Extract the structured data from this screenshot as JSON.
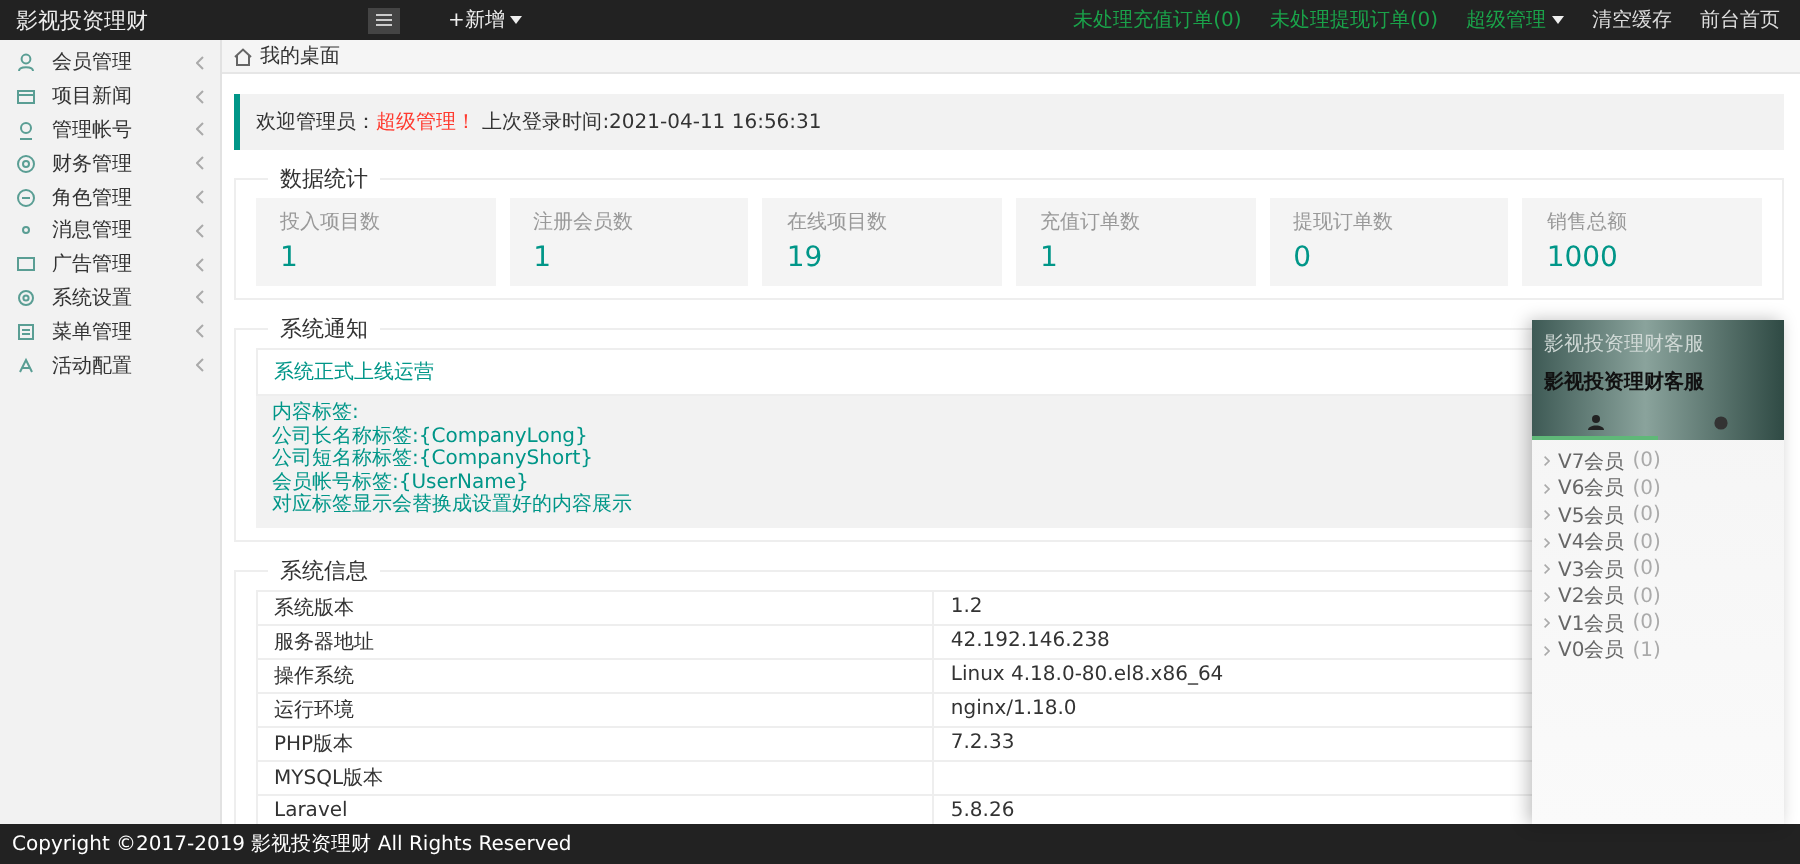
{
  "topbar": {
    "logo": "影视投资理财",
    "add_menu": "+新增",
    "links": [
      {
        "label": "未处理充值订单(0)",
        "kind": "alert"
      },
      {
        "label": "未处理提现订单(0)",
        "kind": "alert"
      },
      {
        "label": "超级管理",
        "kind": "dropdown"
      },
      {
        "label": "清空缓存",
        "kind": "plain"
      },
      {
        "label": "前台首页",
        "kind": "plain"
      }
    ]
  },
  "sidebar": {
    "items": [
      {
        "label": "会员管理"
      },
      {
        "label": "项目新闻"
      },
      {
        "label": "管理帐号"
      },
      {
        "label": "财务管理"
      },
      {
        "label": "角色管理"
      },
      {
        "label": "消息管理"
      },
      {
        "label": "广告管理"
      },
      {
        "label": "系统设置"
      },
      {
        "label": "菜单管理"
      },
      {
        "label": "活动配置"
      }
    ]
  },
  "breadcrumb": "我的桌面",
  "welcome": {
    "prefix": "欢迎管理员：",
    "role": "超级管理！",
    "last_login": "上次登录时间:2021-04-11 16:56:31"
  },
  "stats": {
    "title": "数据统计",
    "cards": [
      {
        "label": "投入项目数",
        "value": "1"
      },
      {
        "label": "注册会员数",
        "value": "1"
      },
      {
        "label": "在线项目数",
        "value": "19"
      },
      {
        "label": "充值订单数",
        "value": "1"
      },
      {
        "label": "提现订单数",
        "value": "0"
      },
      {
        "label": "销售总额",
        "value": "1000"
      }
    ]
  },
  "notice": {
    "title": "系统通知",
    "heading": "系统正式上线运营",
    "lines": [
      "内容标签:",
      "公司长名称标签:{CompanyLong}",
      "公司短名称标签:{CompanyShort}",
      "会员帐号标签:{UserName}",
      "对应标签显示会替换成设置好的内容展示"
    ]
  },
  "system_info": {
    "title": "系统信息",
    "rows": [
      {
        "name": "系统版本",
        "value": "1.2"
      },
      {
        "name": "服务器地址",
        "value": "42.192.146.238"
      },
      {
        "name": "操作系统",
        "value": "Linux 4.18.0-80.el8.x86_64"
      },
      {
        "name": "运行环境",
        "value": "nginx/1.18.0"
      },
      {
        "name": "PHP版本",
        "value": "7.2.33"
      },
      {
        "name": "MYSQL版本"
      },
      {
        "name": "Laravel",
        "value": "5.8.26"
      }
    ]
  },
  "chat_panel": {
    "title": "影视投资理财客服",
    "subtitle": "影视投资理财客服",
    "tabs": [
      {
        "kind": "person",
        "selected": true
      },
      {
        "kind": "chat",
        "selected": false
      }
    ],
    "groups": [
      {
        "label": "V7会员",
        "count": "(0)"
      },
      {
        "label": "V6会员",
        "count": "(0)"
      },
      {
        "label": "V5会员",
        "count": "(0)"
      },
      {
        "label": "V4会员",
        "count": "(0)"
      },
      {
        "label": "V3会员",
        "count": "(0)"
      },
      {
        "label": "V2会员",
        "count": "(0)"
      },
      {
        "label": "V1会员",
        "count": "(0)"
      },
      {
        "label": "V0会员",
        "count": "(1)"
      }
    ]
  },
  "footer": "Copyright ©2017-2019 影视投资理财 All Rights Reserved"
}
